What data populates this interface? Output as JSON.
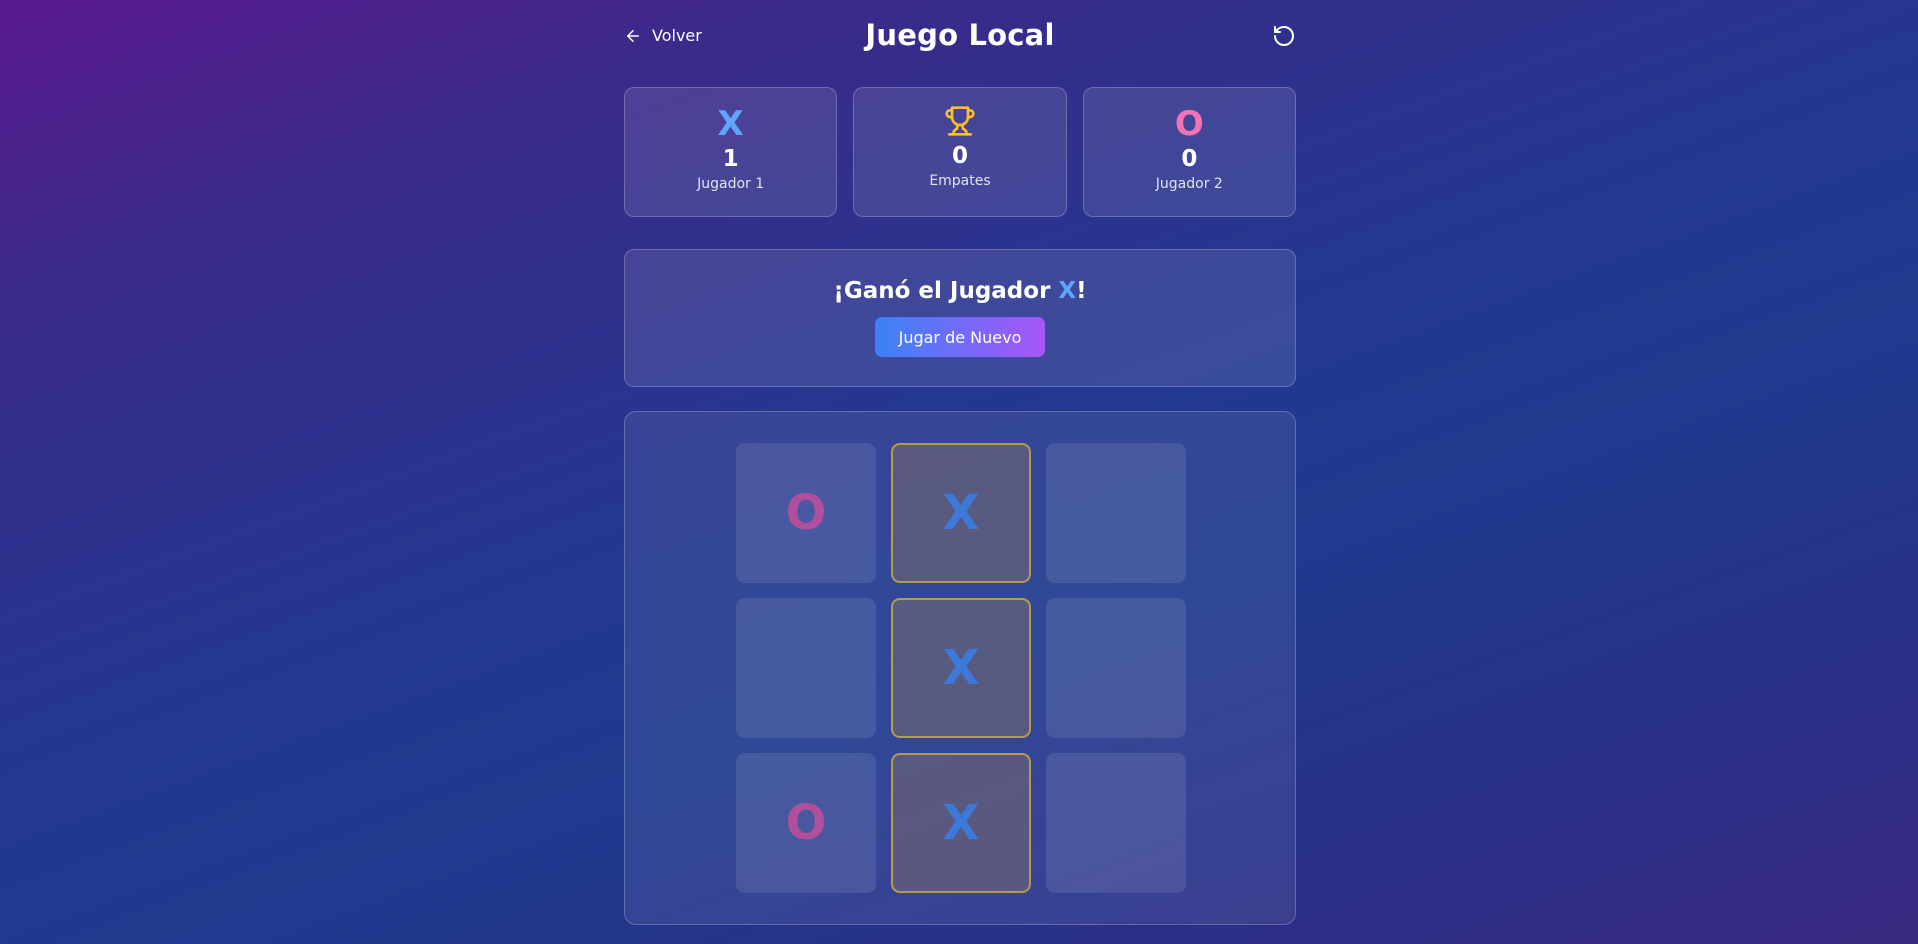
{
  "header": {
    "back_label": "Volver",
    "title": "Juego Local",
    "reset_icon": "rotate-ccw-icon"
  },
  "scores": {
    "player1": {
      "symbol": "X",
      "count": "1",
      "label": "Jugador 1",
      "color": "#60a5fa"
    },
    "draws": {
      "icon": "trophy-icon",
      "count": "0",
      "label": "Empates",
      "color": "#fbbf24"
    },
    "player2": {
      "symbol": "O",
      "count": "0",
      "label": "Jugador 2",
      "color": "#f472b6"
    }
  },
  "result": {
    "prefix": "¡Ganó el Jugador ",
    "winner": "X",
    "suffix": "!",
    "play_again_label": "Jugar de Nuevo"
  },
  "board": {
    "cells": [
      {
        "value": "O",
        "win": false
      },
      {
        "value": "X",
        "win": true
      },
      {
        "value": "",
        "win": false
      },
      {
        "value": "",
        "win": false
      },
      {
        "value": "X",
        "win": true
      },
      {
        "value": "",
        "win": false
      },
      {
        "value": "O",
        "win": false
      },
      {
        "value": "X",
        "win": true
      },
      {
        "value": "",
        "win": false
      }
    ]
  }
}
